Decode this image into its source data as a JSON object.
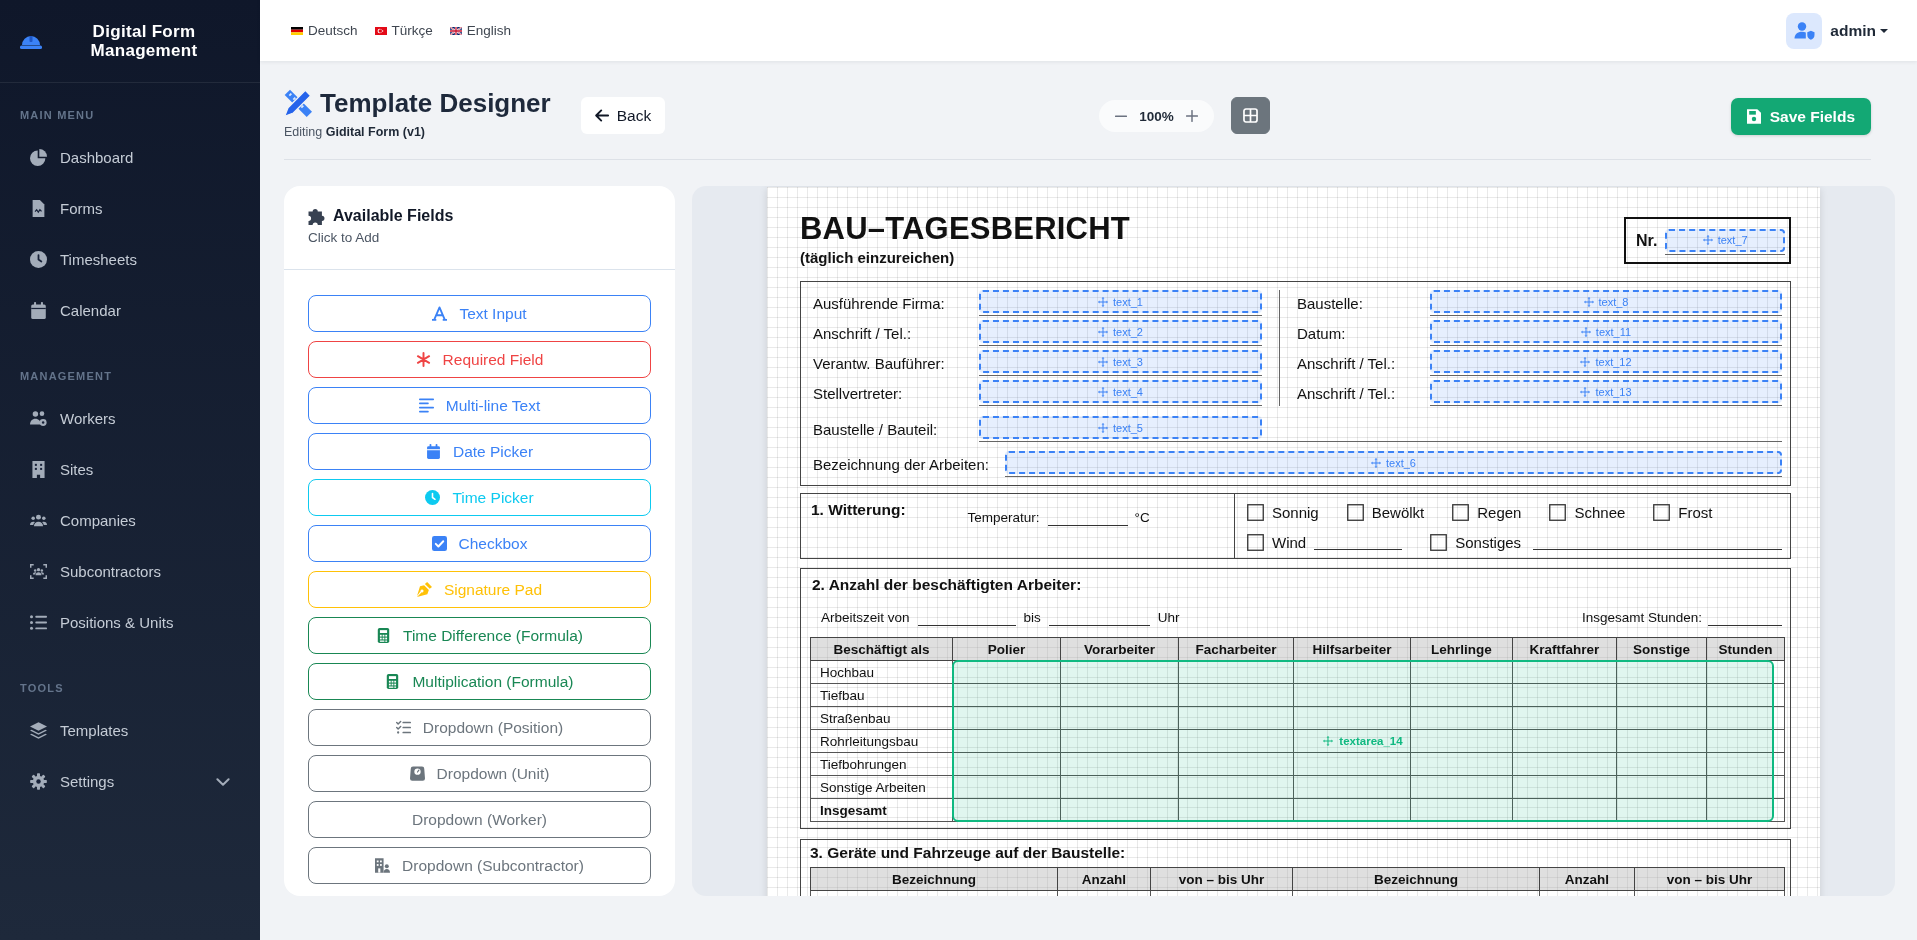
{
  "topbar": {
    "languages": [
      {
        "label": "Deutsch"
      },
      {
        "label": "Türkçe"
      },
      {
        "label": "English"
      }
    ],
    "user": {
      "name": "admin"
    }
  },
  "sidebar": {
    "brand": "Digital Form Management",
    "sections": [
      {
        "title": "MAIN MENU",
        "items": [
          {
            "label": "Dashboard",
            "selected": false
          },
          {
            "label": "Forms",
            "selected": false
          },
          {
            "label": "Timesheets",
            "selected": false
          },
          {
            "label": "Calendar",
            "selected": false
          }
        ]
      },
      {
        "title": "MANAGEMENT",
        "items": [
          {
            "label": "Workers",
            "selected": false
          },
          {
            "label": "Sites",
            "selected": false
          },
          {
            "label": "Companies",
            "selected": false
          },
          {
            "label": "Subcontractors",
            "selected": false
          },
          {
            "label": "Positions & Units",
            "selected": false
          }
        ]
      },
      {
        "title": "TOOLS",
        "items": [
          {
            "label": "Templates",
            "selected": false
          },
          {
            "label": "Settings",
            "selected": false,
            "expanded": false
          }
        ]
      }
    ]
  },
  "header": {
    "title": "Template Designer",
    "subtitle": "Editing **Gidital Form (v1)**",
    "back": "Back",
    "zoom": "100%",
    "grid": {
      "on": true
    },
    "save": "Save Fields"
  },
  "fields": {
    "title": "Available Fields",
    "hint": "Click to Add",
    "items": [
      {
        "label": "Text Input",
        "kind": "text",
        "color": "#3b82f6"
      },
      {
        "label": "Required Field",
        "kind": "required",
        "color": "#ef4444"
      },
      {
        "label": "Multi-line Text",
        "kind": "textarea",
        "color": "#3b82f6"
      },
      {
        "label": "Date Picker",
        "kind": "date",
        "color": "#3b82f6"
      },
      {
        "label": "Time Picker",
        "kind": "time",
        "color": "#0dcaf0"
      },
      {
        "label": "Checkbox",
        "kind": "checkbox",
        "color": "#3b82f6"
      },
      {
        "label": "Signature Pad",
        "kind": "signature",
        "color": "#ffc107"
      },
      {
        "label": "Time Difference (Formula)",
        "kind": "time_difference",
        "color": "#198754"
      },
      {
        "label": "Multiplication (Formula)",
        "kind": "multiplication",
        "color": "#198754"
      },
      {
        "label": "Dropdown (Position)",
        "kind": "dropdown_position",
        "color": "#6c757d"
      },
      {
        "label": "Dropdown (Unit)",
        "kind": "dropdown_unit",
        "color": "#6c757d"
      },
      {
        "label": "Dropdown (Worker)",
        "kind": "dropdown_worker",
        "color": "#6c757d"
      },
      {
        "label": "Dropdown (Subcontractor)",
        "kind": "dropdown_subcontractor",
        "color": "#6c757d"
      }
    ]
  },
  "document": {
    "title": "BAU–TAGESBERICHT",
    "subtitle": "(täglich einzureichen)",
    "number": {
      "label": "Nr.",
      "field": {
        "name": "text_7",
        "kind": "text"
      }
    },
    "details": {
      "left": [
        {
          "label": "Ausführende Firma:",
          "field": {
            "name": "text_1",
            "kind": "text"
          }
        },
        {
          "label": "Anschrift / Tel.:",
          "field": {
            "name": "text_2",
            "kind": "text"
          }
        },
        {
          "label": "Verantw. Bauführer:",
          "field": {
            "name": "text_3",
            "kind": "text"
          }
        },
        {
          "label": "Stellvertreter:",
          "field": {
            "name": "text_4",
            "kind": "text"
          }
        },
        {
          "label": "Baustelle / Bauteil:",
          "field": {
            "name": "text_5",
            "kind": "text"
          }
        }
      ],
      "right": [
        {
          "label": "Baustelle:",
          "field": {
            "name": "text_8",
            "kind": "text"
          }
        },
        {
          "label": "Datum:",
          "field": {
            "name": "text_11",
            "kind": "text"
          }
        },
        {
          "label": "Anschrift / Tel.:",
          "field": {
            "name": "text_12",
            "kind": "text"
          }
        },
        {
          "label": "Anschrift / Tel.:",
          "field": {
            "name": "text_13",
            "kind": "text"
          }
        }
      ],
      "works": {
        "label": "Bezeichnung der Arbeiten:",
        "field": {
          "name": "text_6",
          "kind": "text"
        }
      }
    },
    "weather": {
      "title": "1. Witterung:",
      "temperature_label": "Temperatur:",
      "temperature_unit": "°C",
      "option_rows": [
        {
          "options": [
            {
              "label": "Sonnig",
              "kind": "check",
              "checked": false
            },
            {
              "label": "Bewölkt",
              "kind": "check",
              "checked": false
            },
            {
              "label": "Regen",
              "kind": "check",
              "checked": false
            },
            {
              "label": "Schnee",
              "kind": "check",
              "checked": false
            },
            {
              "label": "Frost",
              "kind": "check",
              "checked": false
            }
          ]
        },
        {
          "options": [
            {
              "label": "Wind",
              "kind": "check_line",
              "checked": false
            },
            {
              "label": "Sonstiges",
              "kind": "check_line",
              "checked": false
            }
          ]
        }
      ]
    },
    "workers": {
      "title": "2. Anzahl der beschäftigten Arbeiter:",
      "time_from_label": "Arbeitszeit von",
      "time_to_label": "bis",
      "time_unit": "Uhr",
      "total_hours_label": "Insgesamt Stunden:",
      "columns": [
        "Beschäftigt als",
        "Polier",
        "Vorarbeiter",
        "Facharbeiter",
        "Hilfsarbeiter",
        "Lehrlinge",
        "Kraftfahrer",
        "Sonstige",
        "Stunden"
      ],
      "rows": [
        {
          "label": "Hochbau",
          "kind": "trade"
        },
        {
          "label": "Tiefbau",
          "kind": "trade"
        },
        {
          "label": "Straßenbau",
          "kind": "trade"
        },
        {
          "label": "Rohrleitungsbau",
          "kind": "trade"
        },
        {
          "label": "Tiefbohrungen",
          "kind": "trade"
        },
        {
          "label": "Sonstige Arbeiten",
          "kind": "trade"
        },
        {
          "label": "Insgesamt",
          "kind": "total"
        }
      ],
      "field": {
        "name": "textarea_14",
        "kind": "textarea"
      }
    },
    "equipment": {
      "title": "3. Geräte und Fahrzeuge auf der Baustelle:",
      "columns": [
        "Bezeichnung",
        "Anzahl",
        "von – bis Uhr",
        "Bezeichnung",
        "Anzahl",
        "von – bis Uhr"
      ]
    }
  }
}
